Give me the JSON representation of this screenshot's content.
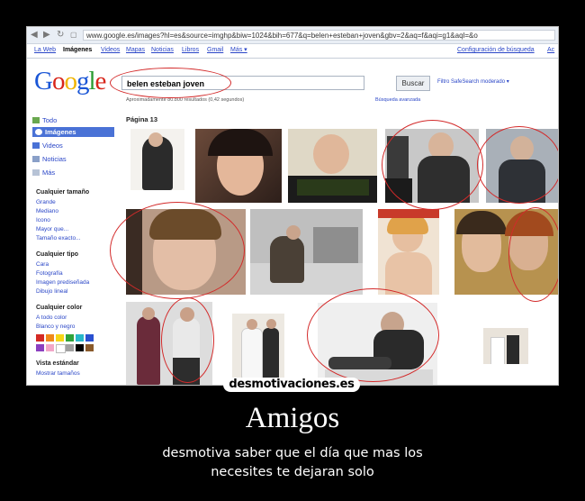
{
  "browser": {
    "url": "www.google.es/images?hl=es&source=imghp&biw=1024&bih=677&q=belen+esteban+joven&gbv=2&aq=f&aqi=g1&aql=&o"
  },
  "topnav": {
    "links": [
      "La Web",
      "Imágenes",
      "Videos",
      "Mapas",
      "Noticias",
      "Libros",
      "Gmail",
      "Más ▾"
    ],
    "settings": "Configuración de búsqueda",
    "signin": "Ac"
  },
  "logo": "Google",
  "search": {
    "query": "belen esteban joven",
    "button": "Buscar",
    "safesearch": "Filtro SafeSearch moderado ▾",
    "results": "Aproximadamente 80.800 resultados (0,42 segundos)",
    "advanced": "Búsqueda avanzada"
  },
  "sidebar": {
    "nav": [
      "Todo",
      "Imágenes",
      "Videos",
      "Noticias",
      "Más"
    ],
    "size_heading": "Cualquier tamaño",
    "size_options": [
      "Grande",
      "Mediano",
      "Icono",
      "Mayor que...",
      "Tamaño exacto..."
    ],
    "type_heading": "Cualquier tipo",
    "type_options": [
      "Cara",
      "Fotografía",
      "Imagen prediseñada",
      "Dibujo lineal"
    ],
    "color_heading": "Cualquier color",
    "color_options": [
      "A todo color",
      "Blanco y negro"
    ],
    "swatches": [
      "#d42a24",
      "#f08a1a",
      "#f5d617",
      "#2fa33a",
      "#27b7c9",
      "#2a50d0",
      "#8b3fc0",
      "#f2a6c8",
      "#ffffff",
      "#a0a0a0",
      "#000000",
      "#8a5a2b"
    ],
    "view_heading": "Vista estándar",
    "view_option": "Mostrar tamaños"
  },
  "content": {
    "page_label": "Página 13"
  },
  "poster": {
    "watermark": "desmotivaciones.es",
    "title": "Amigos",
    "subtitle_line1": "desmotiva saber que el día que mas los",
    "subtitle_line2": "necesites te dejaran solo"
  }
}
